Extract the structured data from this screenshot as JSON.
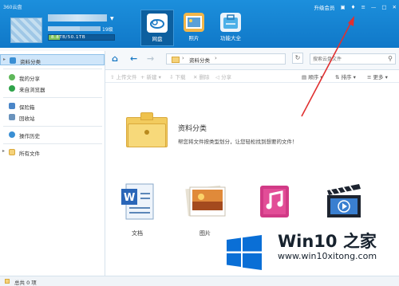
{
  "window": {
    "title": "360云盘"
  },
  "user": {
    "level": "19级",
    "capacity": "8.8TB/50.1TB",
    "capacity_fraction": 0.176
  },
  "nav_tabs": [
    {
      "label": "网盘",
      "active": true
    },
    {
      "label": "照片",
      "active": false
    },
    {
      "label": "功能大全",
      "active": false
    }
  ],
  "topright": {
    "upgrade": "升级会员"
  },
  "address": {
    "path": "资料分类",
    "search_placeholder": "搜索云盘文件"
  },
  "toolbar": {
    "upload": "上传文件",
    "new": "新建",
    "download": "下载",
    "delete": "删除",
    "share": "分享",
    "order": "顺序",
    "sort": "排序",
    "more": "更多"
  },
  "sidebar": {
    "items": [
      {
        "label": "资料分类",
        "icon": "category-icon",
        "selected": true
      },
      {
        "label": "我的分享",
        "icon": "share-icon"
      },
      {
        "label": "来自浏览器",
        "icon": "browser-icon"
      },
      {
        "label": "保险箱",
        "icon": "safe-icon"
      },
      {
        "label": "回收站",
        "icon": "recycle-icon"
      },
      {
        "label": "操作历史",
        "icon": "history-icon"
      },
      {
        "label": "所有文件",
        "icon": "folder-icon"
      }
    ]
  },
  "category": {
    "title": "资料分类",
    "subtitle": "帮您将文件按类型划分，让您轻松找到想要的文件！",
    "tiles": [
      {
        "label": "文档",
        "icon": "document-icon"
      },
      {
        "label": "图片",
        "icon": "picture-icon"
      },
      {
        "label": "",
        "icon": "music-icon"
      },
      {
        "label": "",
        "icon": "video-icon"
      }
    ]
  },
  "status": {
    "text": "总共 0 项"
  },
  "watermark": {
    "brand": "Win10 之家",
    "site": "www.win10xitong.com"
  },
  "colors": {
    "header": "#1478c8",
    "accent": "#1a79c4",
    "arrow": "#e03030",
    "win_blue": "#0a6fd6"
  }
}
